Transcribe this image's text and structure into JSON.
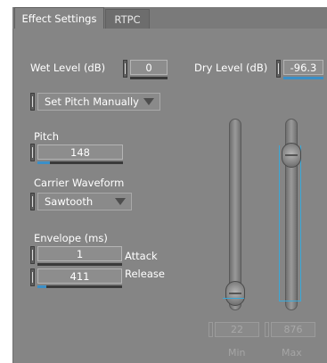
{
  "tabs": [
    {
      "label": "Effect Settings",
      "active": true
    },
    {
      "label": "RTPC",
      "active": false
    }
  ],
  "wet_level": {
    "label": "Wet Level (dB)",
    "value": "0"
  },
  "dry_level": {
    "label": "Dry Level (dB)",
    "value": "-96.3"
  },
  "pitch_mode": {
    "selected": "Set Pitch Manually"
  },
  "pitch": {
    "label": "Pitch",
    "value": "148"
  },
  "carrier_waveform": {
    "label": "Carrier Waveform",
    "selected": "Sawtooth"
  },
  "envelope": {
    "label": "Envelope (ms)",
    "attack": {
      "label": "Attack",
      "value": "1"
    },
    "release": {
      "label": "Release",
      "value": "411"
    }
  },
  "range": {
    "min": {
      "label": "Min",
      "value": "22"
    },
    "max": {
      "label": "Max",
      "value": "876"
    }
  },
  "colors": {
    "panel": "#858585",
    "accent": "#3a8fc8"
  }
}
